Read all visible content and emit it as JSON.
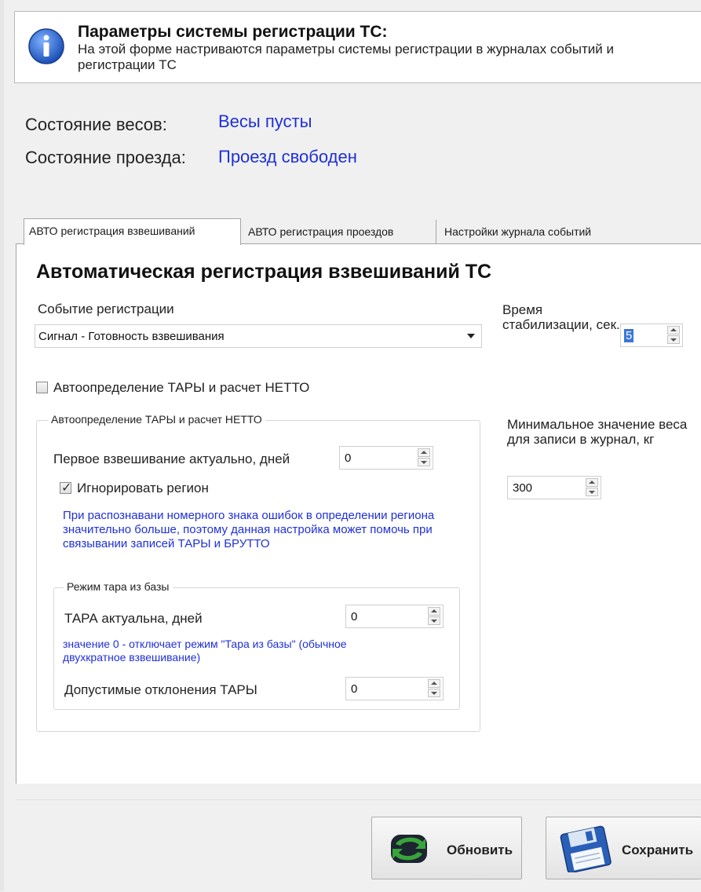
{
  "header": {
    "title": "Параметры системы регистрации ТС:",
    "description": "На этой форме настриваются параметры системы регистрации в журналах событий и регистрации ТС",
    "icon": "info-icon"
  },
  "status": {
    "scales_label": "Состояние весов:",
    "scales_value": "Весы пусты",
    "passage_label": "Состояние проезда:",
    "passage_value": "Проезд свободен",
    "value_color": "#1f30d8"
  },
  "tabs": [
    {
      "label": "АВТО регистрация взвешиваний",
      "active": true
    },
    {
      "label": "АВТО регистрация проездов",
      "active": false
    },
    {
      "label": "Настройки журнала событий",
      "active": false
    }
  ],
  "weighing": {
    "section_title": "Автоматическая регистрация взвешиваний ТС",
    "event_label": "Событие регистрации",
    "event_value": "Сигнал - Готовность взвешивания",
    "stabilization_label": "Время стабилизации, сек.",
    "stabilization_value": "5",
    "tare_checkbox_label": "Автоопределение ТАРЫ и расчет НЕТТО",
    "tare_checkbox_checked": false,
    "auto_group": {
      "title": "Автоопределение ТАРЫ и расчет НЕТТО",
      "first_weighing_label": "Первое взвешивание актуально, дней",
      "first_weighing_value": "0",
      "ignore_region_label": "Игнорировать регион",
      "ignore_region_checked": true,
      "ignore_region_note": "При распознавани номерного знака ошибок в определении региона значительно больше, поэтому данная настройка может помочь при связывании записей ТАРЫ и БРУТТО"
    },
    "tare_group": {
      "title": "Режим тара из базы",
      "tare_actual_label": "ТАРА актуальна, дней",
      "tare_actual_value": "0",
      "tare_note": "значение 0 - отключает режим \"Тара из базы\" (обычное двухкратное взвешивание)",
      "tare_deviation_label": "Допустимые отклонения ТАРЫ",
      "tare_deviation_value": "0"
    },
    "min_weight_label": "Минимальное значение веса для записи в журнал, кг",
    "min_weight_value": "300"
  },
  "buttons": {
    "refresh_label": "Обновить",
    "save_label": "Сохранить"
  }
}
